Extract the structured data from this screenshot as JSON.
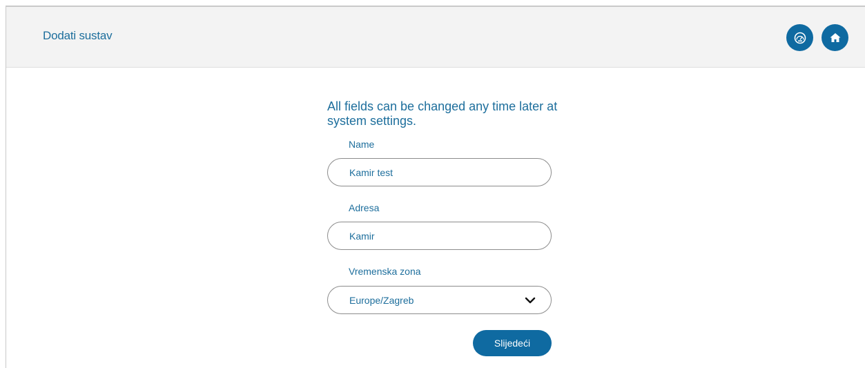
{
  "header": {
    "title": "Dodati sustav",
    "dashboard_icon": "dashboard-gauge-icon",
    "home_icon": "home-icon"
  },
  "form": {
    "intro": "All fields can be changed any time later at system settings.",
    "name": {
      "label": "Name",
      "value": "Kamir test"
    },
    "address": {
      "label": "Adresa",
      "value": "Kamir"
    },
    "timezone": {
      "label": "Vremenska zona",
      "value": "Europe/Zagreb",
      "icon": "chevron-down-icon"
    },
    "next_label": "Slijedeći"
  },
  "colors": {
    "accent": "#0f6aa1",
    "text": "#1d6e9c",
    "header_bg": "#f3f3f3",
    "border": "#8c8c8c"
  }
}
